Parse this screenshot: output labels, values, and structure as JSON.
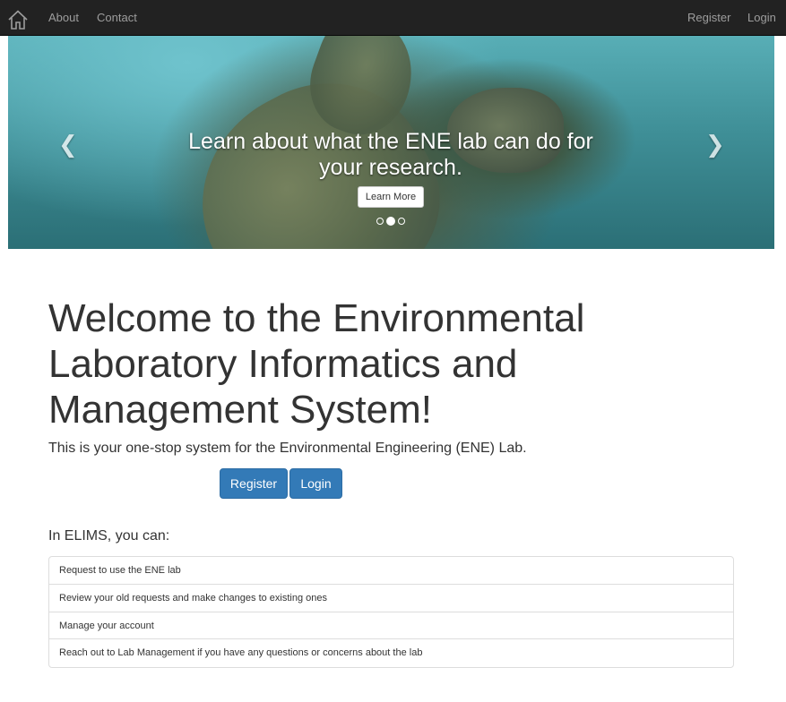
{
  "navbar": {
    "home_icon": "home-icon",
    "left_links": [
      "About",
      "Contact"
    ],
    "right_links": [
      "Register",
      "Login"
    ]
  },
  "carousel": {
    "caption_line1": "Learn about what the ENE lab can do for",
    "caption_line2": "your research.",
    "button_label": "Learn More",
    "prev_icon": "chevron-left-icon",
    "next_icon": "chevron-right-icon",
    "prev_glyph": "❮",
    "next_glyph": "❯",
    "active_slide": 2,
    "slide_count": 3
  },
  "main": {
    "title": "Welcome to the Environmental Laboratory Informatics and Management System!",
    "subtitle": "This is your one-stop system for the Environmental Engineering (ENE) Lab.",
    "register_button": "Register",
    "login_button": "Login",
    "features_heading": "In ELIMS, you can:",
    "features": [
      "Request to use the ENE lab",
      "Review your old requests and make changes to existing ones",
      "Manage your account",
      "Reach out to Lab Management if you have any questions or concerns about the lab"
    ]
  },
  "colors": {
    "navbar_bg": "#222222",
    "nav_text": "#9d9d9d",
    "primary": "#337ab7",
    "text": "#333333"
  }
}
